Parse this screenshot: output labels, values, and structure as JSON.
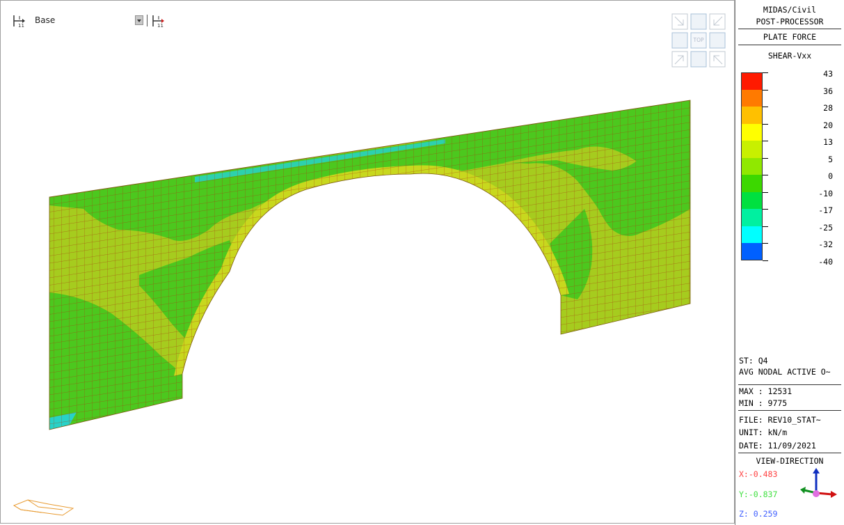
{
  "toolbar": {
    "base_label": "Base",
    "icons": [
      "view-base-icon",
      "dropdown-icon",
      "view-base-alt-icon"
    ]
  },
  "view_cube": {
    "top_label": "TOP"
  },
  "legend": {
    "program_line1": "MIDAS/Civil",
    "program_line2": "POST-PROCESSOR",
    "result_type": "PLATE FORCE",
    "component": "SHEAR-Vxx",
    "scale": [
      {
        "value": "43",
        "color": "#ff1a00"
      },
      {
        "value": "36",
        "color": "#ff7a00"
      },
      {
        "value": "28",
        "color": "#ffc000"
      },
      {
        "value": "20",
        "color": "#ffff00"
      },
      {
        "value": "13",
        "color": "#c8f000"
      },
      {
        "value": "5",
        "color": "#90e800"
      },
      {
        "value": "0",
        "color": "#3cd800"
      },
      {
        "value": "-10",
        "color": "#00e040"
      },
      {
        "value": "-17",
        "color": "#00f0a0"
      },
      {
        "value": "-25",
        "color": "#00ffff"
      },
      {
        "value": "-32",
        "color": "#0060ff"
      }
    ],
    "min_label": "-40",
    "st": "ST: Q4",
    "avg": "AVG NODAL ACTIVE O~",
    "max": "MAX : 12531",
    "min": "MIN : 9775",
    "file": "FILE: REV10_STAT~",
    "unit": "UNIT: kN/m",
    "date": "DATE: 11/09/2021",
    "view_direction_title": "VIEW-DIRECTION",
    "view_x": "X:-0.483",
    "view_y": "Y:-0.837",
    "view_z": "Z: 0.259",
    "x_color": "#ff4040",
    "y_color": "#40e040",
    "z_color": "#4060ff"
  },
  "model_colors": {
    "base": "#9ccc1e",
    "green": "#46c81e",
    "yellow_green": "#b4d21e",
    "red": "#d22800",
    "orange": "#e6a000",
    "cyan": "#28d2c8",
    "mesh": "#a83a10"
  }
}
